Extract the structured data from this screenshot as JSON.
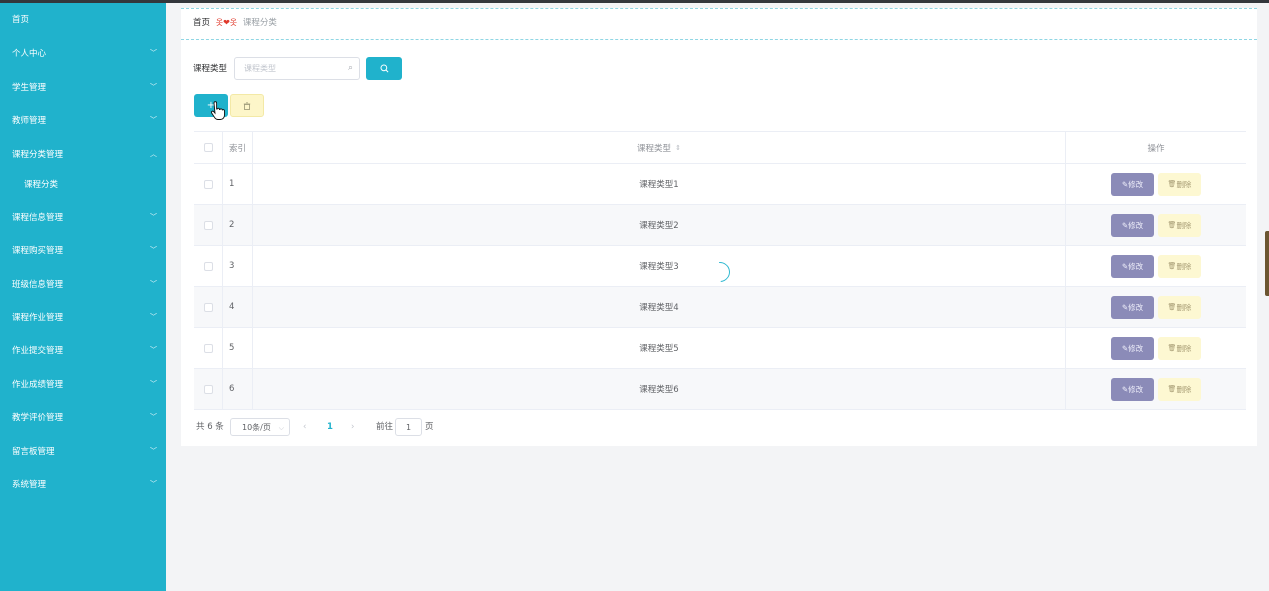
{
  "sidebar": {
    "items": [
      {
        "label": "首页",
        "has_arrow": false
      },
      {
        "label": "个人中心",
        "has_arrow": true
      },
      {
        "label": "学生管理",
        "has_arrow": true
      },
      {
        "label": "教师管理",
        "has_arrow": true
      },
      {
        "label": "课程分类管理",
        "has_arrow": true,
        "expanded": true
      },
      {
        "label": "课程分类",
        "has_arrow": false,
        "sub": true
      },
      {
        "label": "课程信息管理",
        "has_arrow": true
      },
      {
        "label": "课程购买管理",
        "has_arrow": true
      },
      {
        "label": "班级信息管理",
        "has_arrow": true
      },
      {
        "label": "课程作业管理",
        "has_arrow": true
      },
      {
        "label": "作业提交管理",
        "has_arrow": true
      },
      {
        "label": "作业成绩管理",
        "has_arrow": true
      },
      {
        "label": "教学评价管理",
        "has_arrow": true
      },
      {
        "label": "留言板管理",
        "has_arrow": true
      },
      {
        "label": "系统管理",
        "has_arrow": true
      }
    ]
  },
  "breadcrumb": {
    "home": "首页",
    "separator": "옷❤옷",
    "current": "课程分类"
  },
  "search": {
    "label": "课程类型",
    "placeholder": "课程类型",
    "button_icon": "search-icon"
  },
  "toolbar": {
    "add_icon": "plus-icon",
    "delete_icon": "trash-icon"
  },
  "table": {
    "headers": {
      "index": "索引",
      "type": "课程类型",
      "ops": "操作"
    },
    "rows": [
      {
        "index": "1",
        "type": "课程类型1"
      },
      {
        "index": "2",
        "type": "课程类型2"
      },
      {
        "index": "3",
        "type": "课程类型3"
      },
      {
        "index": "4",
        "type": "课程类型4"
      },
      {
        "index": "5",
        "type": "课程类型5"
      },
      {
        "index": "6",
        "type": "课程类型6"
      }
    ],
    "edit_label": "修改",
    "delete_label": "删除"
  },
  "pager": {
    "total": "共 6 条",
    "page_size": "10条/页",
    "prev": "‹",
    "current_page": "1",
    "next": "›",
    "goto_label": "前往",
    "goto_value": "1",
    "page_suffix": "页"
  },
  "colors": {
    "accent": "#20b2cc",
    "edit": "#8b8bb8",
    "delete_bg": "#fdf8d2"
  }
}
